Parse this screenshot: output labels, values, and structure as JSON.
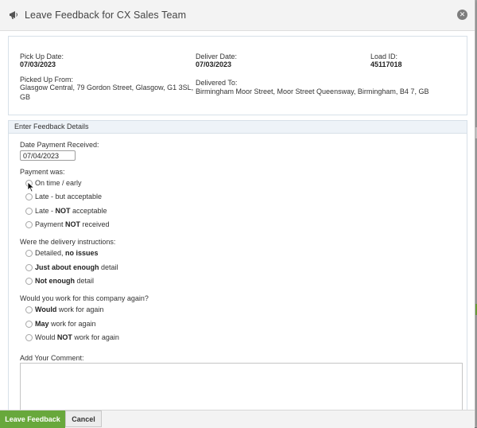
{
  "dialog": {
    "title": "Leave Feedback for CX Sales Team",
    "close_glyph": "✕",
    "icons": {
      "title": "megaphone-icon",
      "close": "close-icon"
    }
  },
  "load_details": {
    "pickup_date_label": "Pick Up Date:",
    "pickup_date": "07/03/2023",
    "deliver_date_label": "Deliver Date:",
    "deliver_date": "07/03/2023",
    "load_id_label": "Load ID:",
    "load_id": "45117018",
    "picked_up_from_label": "Picked Up From:",
    "picked_up_from_line1": "Glasgow Central, 79 Gordon Street, Glasgow, G1 3SL,",
    "picked_up_from_line2": "GB",
    "delivered_to_label": "Delivered To:",
    "delivered_to": "Birmingham Moor Street, Moor Street Queensway, Birmingham, B4 7, GB"
  },
  "feedback": {
    "section_title": "Enter Feedback Details",
    "date_payment_label": "Date Payment Received:",
    "date_payment_value": "07/04/2023",
    "payment_question": "Payment was:",
    "payment_options": [
      {
        "pre": "On time / early",
        "bold": "",
        "post": ""
      },
      {
        "pre": "Late - but acceptable",
        "bold": "",
        "post": ""
      },
      {
        "pre": "Late - ",
        "bold": "NOT",
        "post": " acceptable"
      },
      {
        "pre": "Payment ",
        "bold": "NOT",
        "post": " received"
      }
    ],
    "delivery_question": "Were the delivery instructions:",
    "delivery_options": [
      {
        "pre": "Detailed, ",
        "bold": "no issues",
        "post": ""
      },
      {
        "pre": "",
        "bold": "Just about enough",
        "post": " detail"
      },
      {
        "pre": "",
        "bold": "Not enough",
        "post": " detail"
      }
    ],
    "work_again_question": "Would you work for this company again?",
    "work_again_options": [
      {
        "pre": "",
        "bold": "Would",
        "post": " work for again"
      },
      {
        "pre": "",
        "bold": "May",
        "post": " work for again"
      },
      {
        "pre": "Would ",
        "bold": "NOT",
        "post": " work for again"
      }
    ],
    "comment_label": "Add Your Comment:",
    "comment_value": ""
  },
  "footer": {
    "submit_label": "Leave Feedback",
    "cancel_label": "Cancel"
  },
  "colors": {
    "primary_button": "#68a83c",
    "section_header_bg": "#eef3f8"
  }
}
